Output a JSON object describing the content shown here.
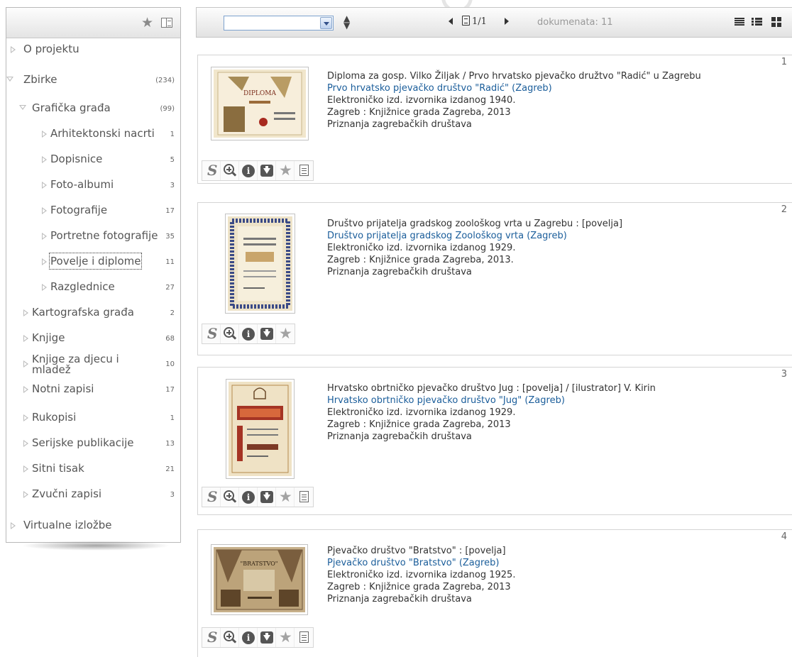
{
  "sidebar": {
    "tree": [
      {
        "label": "O projektu",
        "count": "",
        "state": "closed",
        "level": 0
      },
      {
        "label": "Zbirke",
        "count": "(234)",
        "state": "open",
        "level": 0
      },
      {
        "label": "Grafička građa",
        "count": "(99)",
        "state": "open",
        "level": 1
      },
      {
        "label": "Arhitektonski nacrti",
        "count": "1",
        "state": "closed",
        "level": 2
      },
      {
        "label": "Dopisnice",
        "count": "5",
        "state": "closed",
        "level": 2
      },
      {
        "label": "Foto-albumi",
        "count": "3",
        "state": "closed",
        "level": 2
      },
      {
        "label": "Fotografije",
        "count": "17",
        "state": "closed",
        "level": 2
      },
      {
        "label": "Portretne fotografije",
        "count": "35",
        "state": "closed",
        "level": 2
      },
      {
        "label": "Povelje i diplome",
        "count": "11",
        "state": "closed",
        "level": 2,
        "focused": true
      },
      {
        "label": "Razglednice",
        "count": "27",
        "state": "closed",
        "level": 2
      },
      {
        "label": "Kartografska građa",
        "count": "2",
        "state": "closed",
        "level": 1
      },
      {
        "label": "Knjige",
        "count": "68",
        "state": "closed",
        "level": 1
      },
      {
        "label": "Knjige za djecu i mladež",
        "count": "10",
        "state": "closed",
        "level": 1,
        "wrap": true
      },
      {
        "label": "Notni zapisi",
        "count": "17",
        "state": "closed",
        "level": 1
      },
      {
        "label": "Rukopisi",
        "count": "1",
        "state": "closed",
        "level": 1
      },
      {
        "label": "Serijske publikacije",
        "count": "13",
        "state": "closed",
        "level": 1
      },
      {
        "label": "Sitni tisak",
        "count": "21",
        "state": "closed",
        "level": 1
      },
      {
        "label": "Zvučni zapisi",
        "count": "3",
        "state": "closed",
        "level": 1
      },
      {
        "label": "Virtualne izložbe",
        "count": "",
        "state": "closed",
        "level": 0
      }
    ]
  },
  "toolbar": {
    "select_value": "",
    "page_text": "1/1",
    "documents_label": "dokumenata: 11"
  },
  "records": [
    {
      "num": "1",
      "title": "Diploma za gosp. Vilko Žiljak / Prvo hrvatsko pjevačko družtvo \"Radić\" u Zagrebu",
      "author": "Prvo hrvatsko pjevačko društvo \"Radić\" (Zagreb)",
      "edition": "Elektroničko izd. izvornika izdanog 1940.",
      "publisher": "Zagreb : Knjižnice grada Zagreba, 2013",
      "series": "Priznanja zagrebačkih društava",
      "thumb_text": "DIPLOMA",
      "has_doc_action": true
    },
    {
      "num": "2",
      "title": "Društvo prijatelja gradskog zoološkog vrta u Zagrebu : [povelja]",
      "author": "Društvo prijatelja gradskog Zoološkog vrta (Zagreb)",
      "edition": "Elektroničko izd. izvornika izdanog 1929.",
      "publisher": "Zagreb : Knjižnice grada Zagreba, 2013.",
      "series": "Priznanja zagrebačkih društava",
      "thumb_text": "",
      "has_doc_action": false
    },
    {
      "num": "3",
      "title": "Hrvatsko obrtničko pjevačko društvo Jug : [povelja] / [ilustrator] V. Kirin",
      "author": "Hrvatsko obrtničko pjevačko društvo \"Jug\" (Zagreb)",
      "edition": "Elektroničko izd. izvornika izdanog 1929.",
      "publisher": "Zagreb : Knjižnice grada Zagreba, 2013",
      "series": "Priznanja zagrebačkih društava",
      "thumb_text": "",
      "has_doc_action": true
    },
    {
      "num": "4",
      "title": "Pjevačko društvo \"Bratstvo\" : [povelja]",
      "author": "Pjevačko društvo \"Bratstvo\" (Zagreb)",
      "edition": "Elektroničko izd. izvornika izdanog 1925.",
      "publisher": "Zagreb : Knjižnice grada Zagreba, 2013",
      "series": "Priznanja zagrebačkih društava",
      "thumb_text": "\"BRATSTVO\"",
      "has_doc_action": true
    }
  ],
  "colors": {
    "link": "#1a5d9a",
    "text": "#333333",
    "muted": "#999999"
  }
}
